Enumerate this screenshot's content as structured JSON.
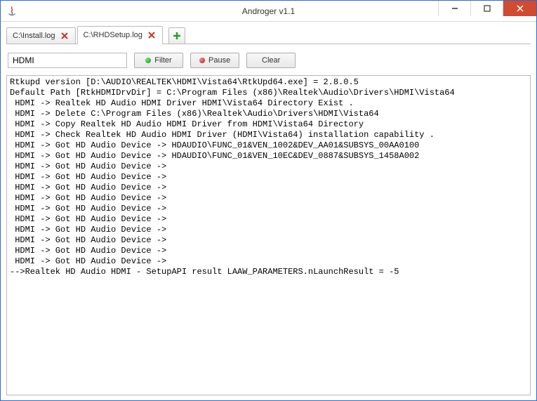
{
  "window": {
    "title": "Androger v1.1"
  },
  "tabs": [
    {
      "label": "C:\\Install.log",
      "active": false
    },
    {
      "label": "C:\\RHDSetup.log",
      "active": true
    }
  ],
  "toolbar": {
    "filter_value": "HDMI",
    "filter_label": "Filter",
    "pause_label": "Pause",
    "clear_label": "Clear"
  },
  "log_lines": [
    "Rtkupd version [D:\\AUDIO\\REALTEK\\HDMI\\Vista64\\RtkUpd64.exe] = 2.8.0.5",
    "Default Path [RtkHDMIDrvDir] = C:\\Program Files (x86)\\Realtek\\Audio\\Drivers\\HDMI\\Vista64",
    " HDMI -> Realtek HD Audio HDMI Driver HDMI\\Vista64 Directory Exist .",
    " HDMI -> Delete C:\\Program Files (x86)\\Realtek\\Audio\\Drivers\\HDMI\\Vista64",
    " HDMI -> Copy Realtek HD Audio HDMI Driver from HDMI\\Vista64 Directory",
    " HDMI -> Check Realtek HD Audio HDMI Driver (HDMI\\Vista64) installation capability .",
    " HDMI -> Got HD Audio Device -> HDAUDIO\\FUNC_01&VEN_1002&DEV_AA01&SUBSYS_00AA0100",
    " HDMI -> Got HD Audio Device -> HDAUDIO\\FUNC_01&VEN_10EC&DEV_0887&SUBSYS_1458A002",
    " HDMI -> Got HD Audio Device -> ",
    " HDMI -> Got HD Audio Device -> ",
    " HDMI -> Got HD Audio Device -> ",
    " HDMI -> Got HD Audio Device -> ",
    " HDMI -> Got HD Audio Device -> ",
    " HDMI -> Got HD Audio Device -> ",
    " HDMI -> Got HD Audio Device -> ",
    " HDMI -> Got HD Audio Device -> ",
    " HDMI -> Got HD Audio Device -> ",
    " HDMI -> Got HD Audio Device -> ",
    "-->Realtek HD Audio HDMI - SetupAPI result LAAW_PARAMETERS.nLaunchResult = -5"
  ]
}
